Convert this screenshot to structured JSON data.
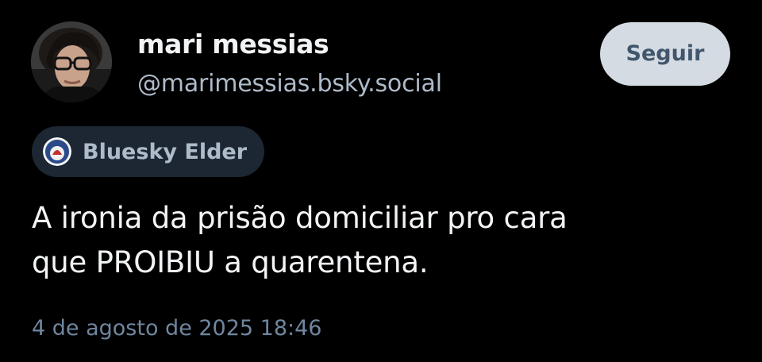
{
  "author": {
    "display_name": "mari messias",
    "handle": "@marimessias.bsky.social"
  },
  "follow_button": {
    "label": "Seguir"
  },
  "badge": {
    "label": "Bluesky Elder"
  },
  "post": {
    "text_lines": [
      "A ironia da prisão domiciliar pro cara",
      "que PROIBIU a quarentena."
    ],
    "timestamp": "4 de agosto de 2025 18:46"
  },
  "colors": {
    "background": "#000000",
    "primary_text": "#f1f3f5",
    "secondary_text": "#aebbc9",
    "timestamp_text": "#6f869f",
    "follow_button_bg": "#d4dbe2",
    "follow_button_text": "#42576c",
    "badge_bg": "#1c2733"
  },
  "icons": {
    "avatar": "user-photo-avatar",
    "badge": "bluesky-elder-badge-icon"
  }
}
